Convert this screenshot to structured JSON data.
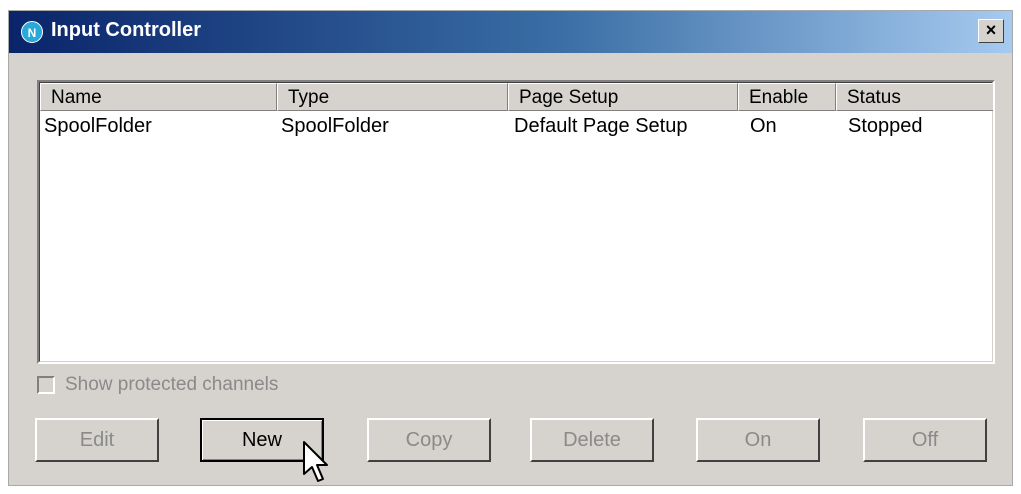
{
  "window": {
    "title": "Input Controller",
    "app_icon": "N",
    "close": "×"
  },
  "list": {
    "columns": [
      "Name",
      "Type",
      "Page Setup",
      "Enable",
      "Status"
    ],
    "rows": [
      [
        "SpoolFolder",
        "SpoolFolder",
        "Default Page Setup",
        "On",
        "Stopped"
      ]
    ]
  },
  "checkbox": {
    "label": "Show protected channels",
    "checked": false
  },
  "buttons": {
    "edit": "Edit",
    "new": "New",
    "copy": "Copy",
    "delete": "Delete",
    "on": "On",
    "off": "Off"
  }
}
